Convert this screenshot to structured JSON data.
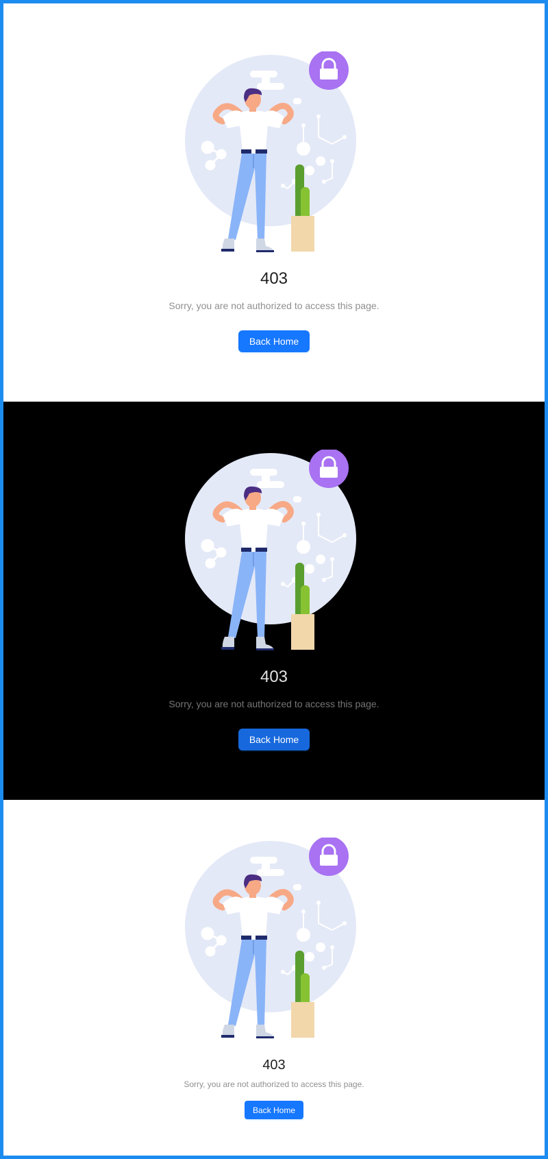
{
  "panels": [
    {
      "id": "light",
      "status_code": "403",
      "subtitle": "Sorry, you are not authorized to access this page.",
      "button_label": "Back Home"
    },
    {
      "id": "dark",
      "status_code": "403",
      "subtitle": "Sorry, you are not authorized to access this page.",
      "button_label": "Back Home"
    },
    {
      "id": "compact",
      "status_code": "403",
      "subtitle": "Sorry, you are not authorized to access this page.",
      "button_label": "Back Home"
    }
  ],
  "colors": {
    "frame_border": "#1d8cf0",
    "primary": "#1677ff",
    "primary_dark": "#1668dc",
    "lock_badge": "#a872f2",
    "illustration_circle": "#e4e9f7"
  },
  "icons": [
    "lock-icon"
  ]
}
